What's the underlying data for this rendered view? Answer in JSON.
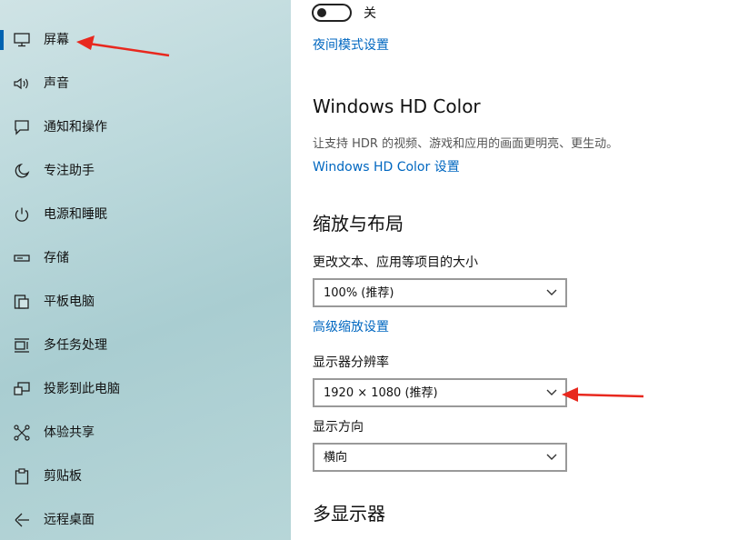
{
  "sidebar": {
    "items": [
      {
        "label": "屏幕",
        "icon": "monitor-icon",
        "selected": true
      },
      {
        "label": "声音",
        "icon": "speaker-icon"
      },
      {
        "label": "通知和操作",
        "icon": "notification-icon"
      },
      {
        "label": "专注助手",
        "icon": "moon-icon"
      },
      {
        "label": "电源和睡眠",
        "icon": "power-icon"
      },
      {
        "label": "存储",
        "icon": "storage-icon"
      },
      {
        "label": "平板电脑",
        "icon": "tablet-icon"
      },
      {
        "label": "多任务处理",
        "icon": "multitasking-icon"
      },
      {
        "label": "投影到此电脑",
        "icon": "project-icon"
      },
      {
        "label": "体验共享",
        "icon": "share-icon"
      },
      {
        "label": "剪贴板",
        "icon": "clipboard-icon"
      },
      {
        "label": "远程桌面",
        "icon": "remote-desktop-icon"
      }
    ]
  },
  "night_light": {
    "toggle_state": "关",
    "settings_link": "夜间模式设置"
  },
  "hd_color": {
    "heading": "Windows HD Color",
    "description": "让支持 HDR 的视频、游戏和应用的画面更明亮、更生动。",
    "settings_link": "Windows HD Color 设置"
  },
  "scale_layout": {
    "heading": "缩放与布局",
    "scale_label": "更改文本、应用等项目的大小",
    "scale_value": "100% (推荐)",
    "advanced_link": "高级缩放设置",
    "resolution_label": "显示器分辨率",
    "resolution_value": "1920 × 1080 (推荐)",
    "orientation_label": "显示方向",
    "orientation_value": "横向"
  },
  "multi_display": {
    "heading": "多显示器"
  },
  "colors": {
    "accent": "#0067c0",
    "annotation_arrow": "#e8281e"
  }
}
